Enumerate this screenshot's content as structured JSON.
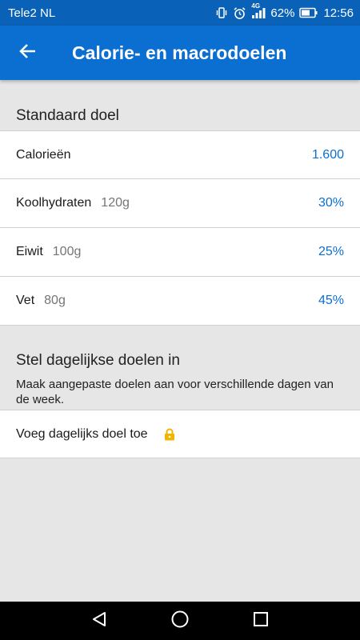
{
  "status_bar": {
    "carrier": "Tele2 NL",
    "network_label": "4G",
    "battery_percent": "62%",
    "time": "12:56",
    "icons": [
      "vibrate-icon",
      "alarm-icon",
      "signal-icon",
      "battery-icon"
    ]
  },
  "app_bar": {
    "title": "Calorie- en macrodoelen",
    "back_icon": "arrow-left-icon"
  },
  "standard_goal": {
    "header": "Standaard doel",
    "rows": [
      {
        "label": "Calorieën",
        "grams": "",
        "value": "1.600"
      },
      {
        "label": "Koolhydraten",
        "grams": "120g",
        "value": "30%"
      },
      {
        "label": "Eiwit",
        "grams": "100g",
        "value": "25%"
      },
      {
        "label": "Vet",
        "grams": "80g",
        "value": "45%"
      }
    ]
  },
  "daily_goals": {
    "header": "Stel dagelijkse doelen in",
    "description": "Maak aangepaste doelen aan voor verschillende dagen van de week.",
    "add_label": "Voeg dagelijks doel toe",
    "lock_icon": "lock-icon"
  },
  "colors": {
    "primary": "#0b6fd1",
    "status_bar": "#0a61b8",
    "accent_value": "#0b6fd1",
    "lock": "#f2b400"
  },
  "nav_bar": {
    "icons": [
      "back-triangle-icon",
      "home-circle-icon",
      "recents-square-icon"
    ]
  }
}
